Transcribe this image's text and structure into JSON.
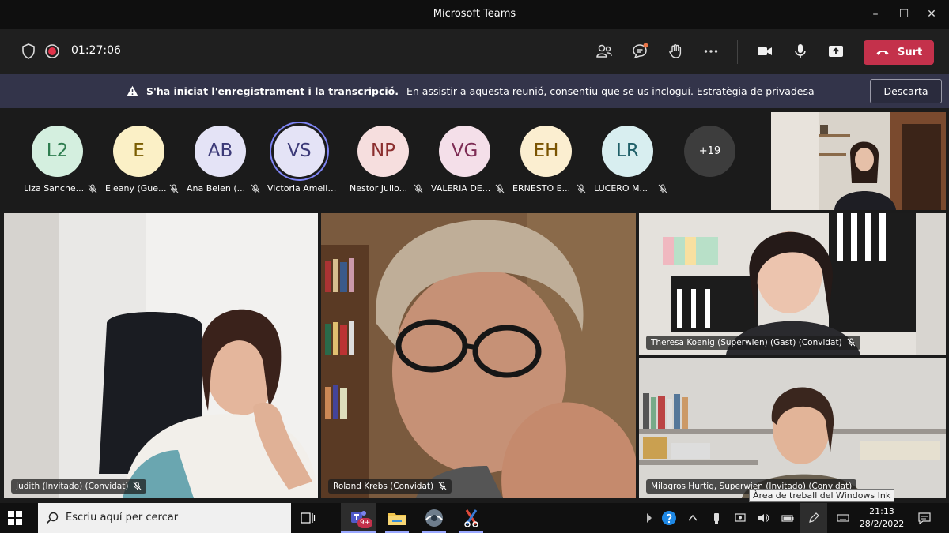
{
  "window": {
    "title": "Microsoft Teams",
    "minimize": "–",
    "maximize": "☐",
    "close": "✕"
  },
  "toolbar": {
    "timer": "01:27:06",
    "leave_label": "Surt"
  },
  "banner": {
    "title": "S'ha iniciat l'enregistrament i la transcripció.",
    "message": "En assistir a aquesta reunió, consentiu que se us incloguí.",
    "link": "Estratègia de privadesa",
    "dismiss": "Descarta"
  },
  "participants": [
    {
      "initials": "L2",
      "name": "Liza Sanche...",
      "bg": "#d4efdf",
      "fg": "#2e7d4f"
    },
    {
      "initials": "E",
      "name": "Eleany (Gue...",
      "bg": "#fbf0c6",
      "fg": "#7a5d00"
    },
    {
      "initials": "AB",
      "name": "Ana Belen (...",
      "bg": "#e4e3f6",
      "fg": "#3c3a78"
    },
    {
      "initials": "VS",
      "name": "Victoria Amelia ...",
      "bg": "#e4e3f6",
      "fg": "#3c3a78"
    },
    {
      "initials": "NP",
      "name": "Nestor Julio...",
      "bg": "#f6dede",
      "fg": "#8b2e2e"
    },
    {
      "initials": "VG",
      "name": "VALERIA DE...",
      "bg": "#f4dfe9",
      "fg": "#7e2d55"
    },
    {
      "initials": "EH",
      "name": "ERNESTO E...",
      "bg": "#fbeed0",
      "fg": "#7a5300"
    },
    {
      "initials": "LR",
      "name": "LUCERO M...",
      "bg": "#d8eef0",
      "fg": "#1f5f68"
    }
  ],
  "more_participants": "+19",
  "videos": [
    {
      "name": "Judith (Invitado) (Convidat)"
    },
    {
      "name": "Roland Krebs (Convidat)"
    },
    {
      "name": "Theresa Koenig (Superwien) (Gast) (Convidat)"
    },
    {
      "name": "Milagros Hurtig, Superwien (Invitado) (Convidat)"
    }
  ],
  "taskbar": {
    "search_placeholder": "Escriu aquí per cercar",
    "teams_badge": "9+",
    "time": "21:13",
    "date": "28/2/2022",
    "tooltip": "Àrea de treball del Windows Ink"
  },
  "colors": {
    "leave": "#c4314b",
    "banner": "#33344a",
    "accent": "#6264a7"
  }
}
